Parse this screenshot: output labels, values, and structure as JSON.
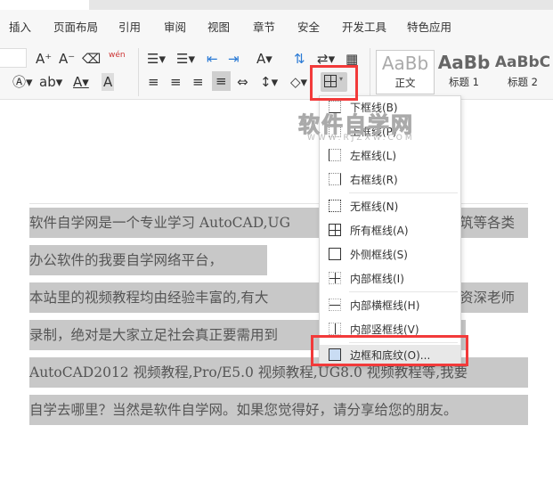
{
  "menubar": [
    "插入",
    "页面布局",
    "引用",
    "审阅",
    "视图",
    "章节",
    "安全",
    "开发工具",
    "特色应用"
  ],
  "styles": [
    {
      "preview": "AaBb",
      "name": "正文"
    },
    {
      "preview": "AaBb",
      "name": "标题 1"
    },
    {
      "preview": "AaBbC",
      "name": "标题 2"
    }
  ],
  "toolbar": {
    "phonetic": "wén"
  },
  "border_menu": {
    "items": [
      "下框线(B)",
      "上框线(P)",
      "左框线(L)",
      "右框线(R)",
      "无框线(N)",
      "所有框线(A)",
      "外侧框线(S)",
      "内部框线(I)",
      "内部横框线(H)",
      "内部竖框线(V)",
      "边框和底纹(O)..."
    ]
  },
  "watermark": {
    "title": "软件自学网",
    "url": "WWW.RJZXW.COM"
  },
  "document": {
    "lines": [
      {
        "left": "软件自学网是一个专业学习 AutoCAD,UG",
        "right": "筑等各类"
      },
      {
        "left": "办公软件的我要自学网络平台，",
        "right": ""
      },
      {
        "left": "本站里的视频教程均由经验丰富的,有大",
        "right": "资深老师"
      },
      {
        "left": "录制，绝对是大家立足社会真正要需用到",
        "right": ""
      },
      {
        "left": "AutoCAD2012 视频教程,Pro/E5.0 视频教程,UG8.0 视频教程等,我要",
        "right": ""
      },
      {
        "left": "自学去哪里？当然是软件自学网。如果您觉得好，请分享给您的朋友。",
        "right": ""
      }
    ]
  }
}
